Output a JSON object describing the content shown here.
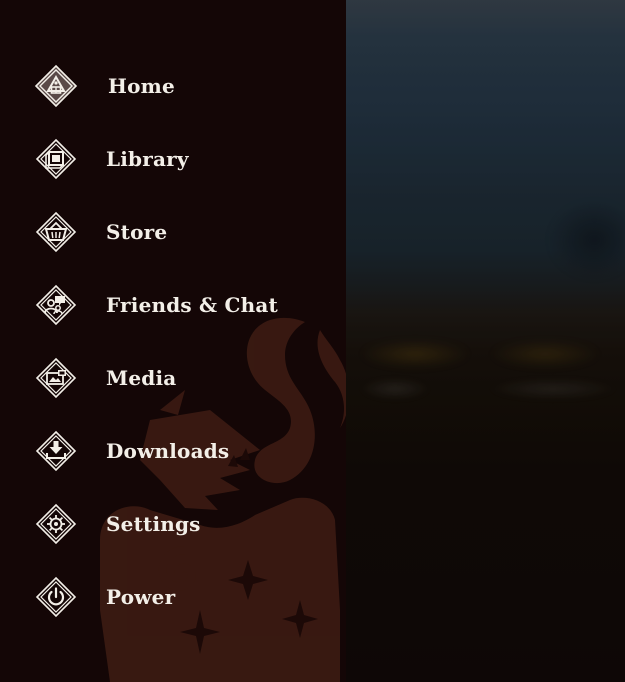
{
  "menu": {
    "items": [
      {
        "id": "home",
        "label": "Home",
        "icon": "home-icon",
        "active": true
      },
      {
        "id": "library",
        "label": "Library",
        "icon": "library-icon",
        "active": false
      },
      {
        "id": "store",
        "label": "Store",
        "icon": "store-basket-icon",
        "active": false
      },
      {
        "id": "friends-chat",
        "label": "Friends & Chat",
        "icon": "friends-chat-icon",
        "active": false
      },
      {
        "id": "media",
        "label": "Media",
        "icon": "media-icon",
        "active": false
      },
      {
        "id": "downloads",
        "label": "Downloads",
        "icon": "download-icon",
        "active": false
      },
      {
        "id": "settings",
        "label": "Settings",
        "icon": "settings-icon",
        "active": false
      },
      {
        "id": "power",
        "label": "Power",
        "icon": "power-icon",
        "active": false
      }
    ]
  },
  "colors": {
    "panel_background": "#140606",
    "label_text": "#f3efe8",
    "icon_stroke": "#f3efe8",
    "emblem": "#3a1a12"
  }
}
